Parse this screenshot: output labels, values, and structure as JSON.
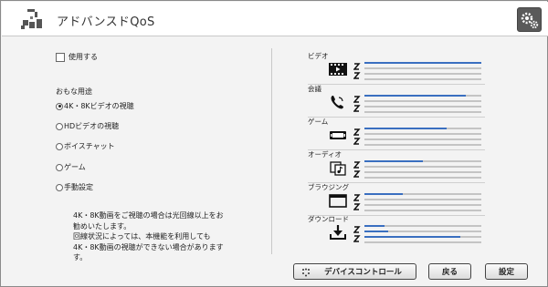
{
  "header": {
    "title": "アドバンスドQoS",
    "settings_icon": "gear-icon"
  },
  "left": {
    "enable_label": "使用する",
    "enable_checked": false,
    "usage_label": "おもな用途",
    "options": [
      {
        "label": "4K・8Kビデオの視聴",
        "selected": true
      },
      {
        "label": "HDビデオの視聴",
        "selected": false
      },
      {
        "label": "ボイスチャット",
        "selected": false
      },
      {
        "label": "ゲーム",
        "selected": false
      },
      {
        "label": "手動設定",
        "selected": false
      }
    ],
    "note_lines": [
      "4K・8K動画をご視聴の場合は光回線以上をお",
      "勧めいたします。",
      "回線状況によっては、本機能を利用しても",
      "4K・8K動画の視聴ができない場合があります",
      "す。"
    ]
  },
  "categories": [
    {
      "label": "ビデオ",
      "icon": "film-icon",
      "levels": [
        1.0,
        0.0,
        0.0,
        0.0
      ]
    },
    {
      "label": "会議",
      "icon": "phone-icon",
      "levels": [
        0.87,
        0.0,
        0.0,
        0.0
      ]
    },
    {
      "label": "ゲーム",
      "icon": "gamepad-icon",
      "levels": [
        0.7,
        0.0,
        0.0,
        0.0
      ]
    },
    {
      "label": "オーディオ",
      "icon": "audio-icon",
      "levels": [
        0.5,
        0.0,
        0.0,
        0.0
      ]
    },
    {
      "label": "ブラウジング",
      "icon": "browser-window-icon",
      "levels": [
        0.33,
        0.0,
        0.0,
        0.0
      ]
    },
    {
      "label": "ダウンロード",
      "icon": "download-icon",
      "levels": [
        0.17,
        0.2,
        0.82,
        0.0
      ]
    }
  ],
  "buttons": {
    "device_control": "デバイスコントロール",
    "back": "戻る",
    "settings": "設定"
  },
  "colors": {
    "bar_fill": "#3a6fc0",
    "bar_track": "#c4c4c4"
  }
}
